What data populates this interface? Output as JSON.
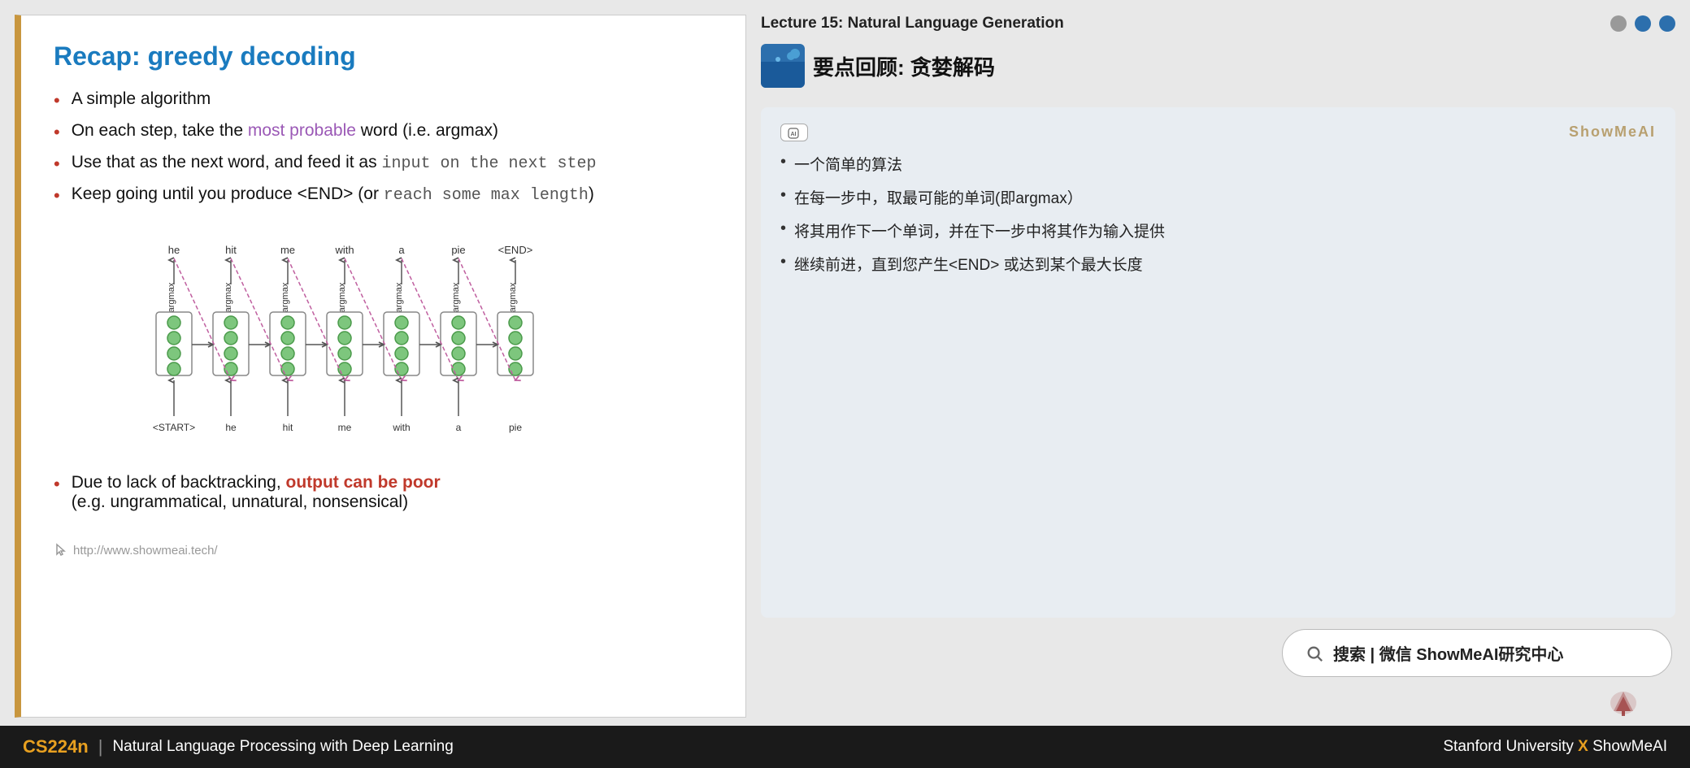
{
  "slide": {
    "title": "Recap: greedy decoding",
    "bullets": [
      {
        "text": "A simple algorithm",
        "highlight": null
      },
      {
        "parts": [
          {
            "text": "On each step, take the ",
            "style": "normal"
          },
          {
            "text": "most probable",
            "style": "purple"
          },
          {
            "text": " word (i.e. argmax)",
            "style": "normal"
          }
        ]
      },
      {
        "parts": [
          {
            "text": "Use that as the next word, and feed it as ",
            "style": "normal"
          },
          {
            "text": "input on the next step",
            "style": "mono"
          }
        ]
      },
      {
        "parts": [
          {
            "text": "Keep going until you produce <END> (or ",
            "style": "normal"
          },
          {
            "text": "reach some max length",
            "style": "mono"
          },
          {
            "text": ")",
            "style": "normal"
          }
        ]
      }
    ],
    "bottom_bullet": {
      "part1": "Due to lack of backtracking, ",
      "part2": "output can be poor",
      "part3": " (e.g. ungrammatical, unnatural, nonsensical)"
    },
    "source_link": "http://www.showmeai.tech/"
  },
  "right": {
    "lecture_title": "Lecture 15: Natural Language Generation",
    "section_title": "要点回顾: 贪婪解码",
    "ai_badge": "AI",
    "watermark": "ShowMeAI",
    "translation_items": [
      "一个简单的算法",
      "在每一步中，取最可能的单词(即argmax）",
      "将其用作下一个单词，并在下一步中将其作为输入提供",
      "继续前进，直到您产生<END> 或达到某个最大长度"
    ],
    "search_label": "搜索 | 微信 ShowMeAI研究中心"
  },
  "footer": {
    "course_code": "CS224n",
    "course_name": "Natural Language Processing with Deep Learning",
    "university": "Stanford University",
    "x_mark": "X",
    "brand": "ShowMeAI"
  },
  "diagram": {
    "words_top": [
      "he",
      "hit",
      "me",
      "with",
      "a",
      "pie",
      "<END>"
    ],
    "words_bottom": [
      "<START>",
      "he",
      "hit",
      "me",
      "with",
      "a",
      "pie"
    ],
    "argmax_label": "argmax"
  }
}
